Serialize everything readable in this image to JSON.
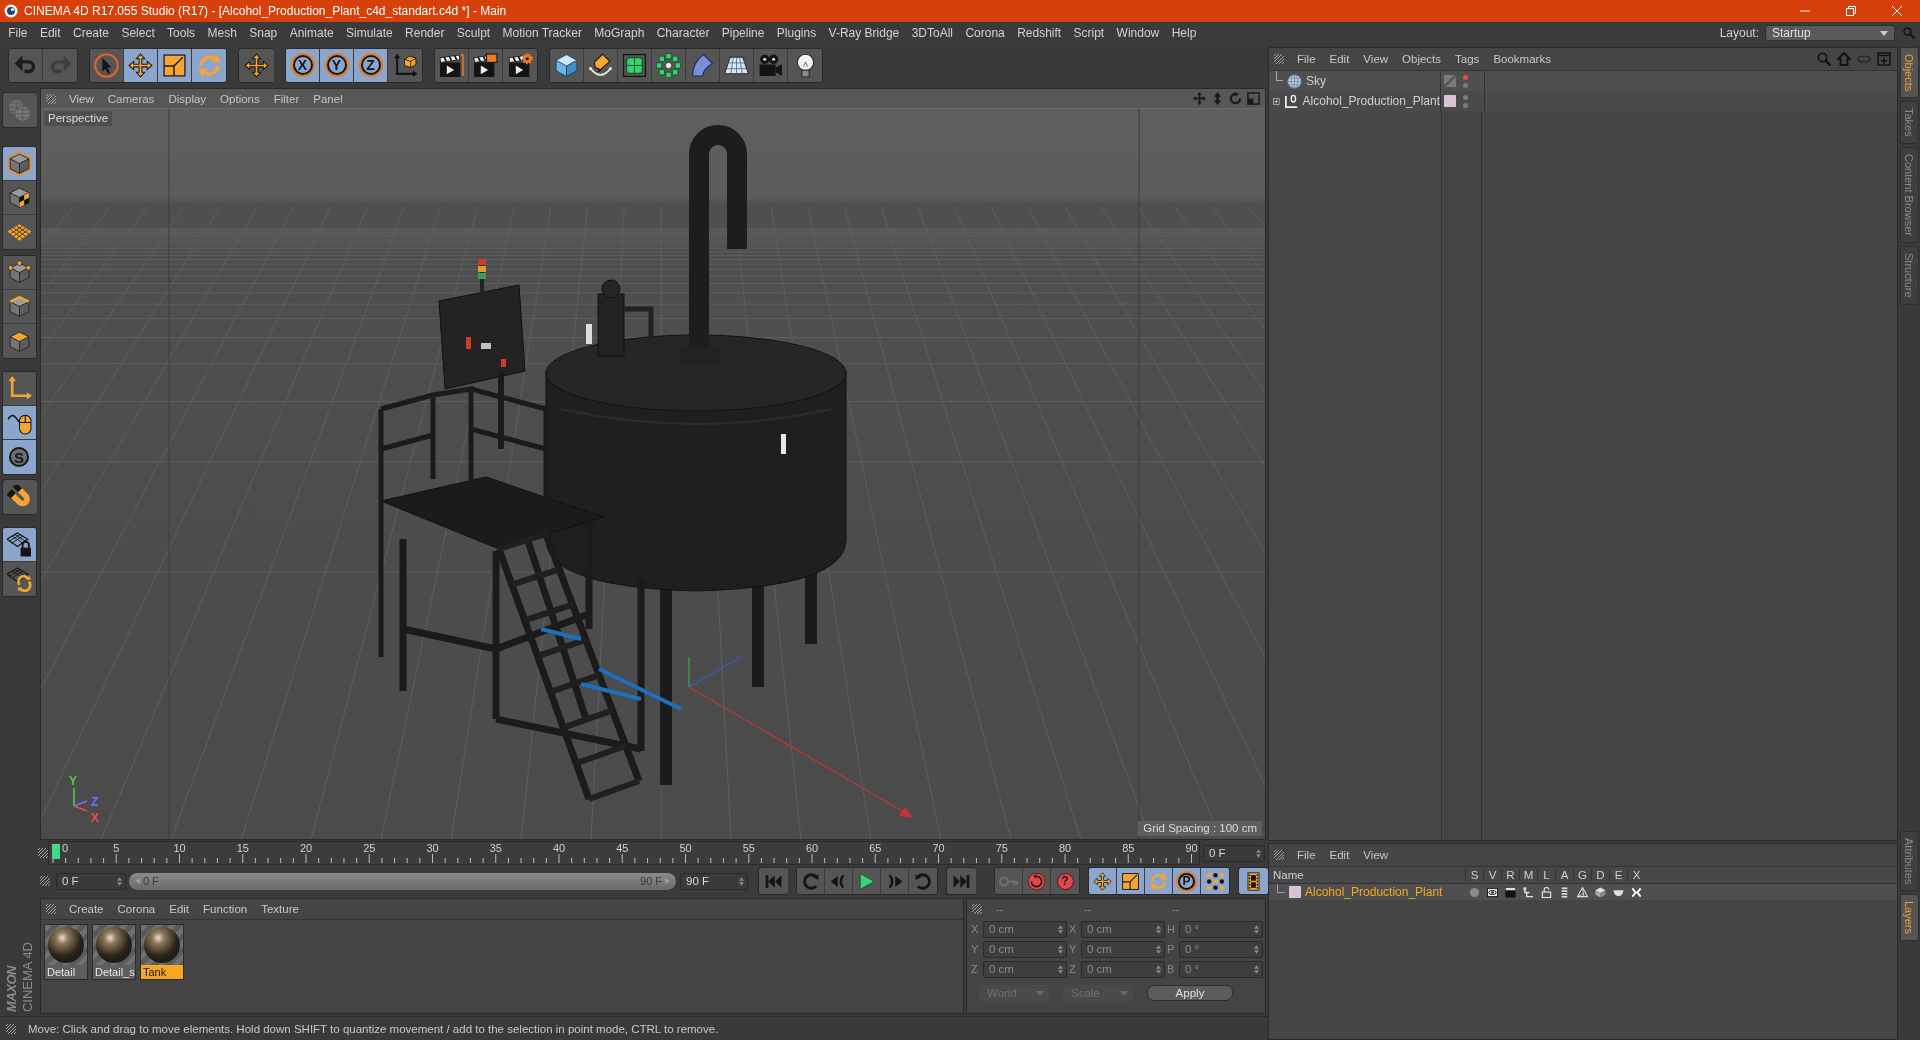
{
  "window": {
    "title": "CINEMA 4D R17.055 Studio (R17) - [Alcohol_Production_Plant_c4d_standart.c4d *] - Main"
  },
  "menu_bar": {
    "items": [
      "File",
      "Edit",
      "Create",
      "Select",
      "Tools",
      "Mesh",
      "Snap",
      "Animate",
      "Simulate",
      "Render",
      "Sculpt",
      "Motion Tracker",
      "MoGraph",
      "Character",
      "Pipeline",
      "Plugins",
      "V-Ray Bridge",
      "3DToAll",
      "Corona",
      "Redshift",
      "Script",
      "Window",
      "Help"
    ],
    "layout_label": "Layout:",
    "layout_value": "Startup"
  },
  "toolbar": [
    [
      {
        "active": false,
        "disabled": false
      },
      {
        "active": false,
        "disabled": true
      }
    ],
    [
      {
        "active": false,
        "disabled": false
      },
      {
        "active": true,
        "disabled": false
      },
      {
        "active": true,
        "disabled": false
      },
      {
        "active": true,
        "disabled": false
      }
    ],
    [
      {
        "active": false,
        "disabled": false
      }
    ],
    [
      {
        "active": true,
        "disabled": false,
        "label": "X"
      },
      {
        "active": true,
        "disabled": false,
        "label": "Y"
      },
      {
        "active": true,
        "disabled": false,
        "label": "Z"
      },
      {
        "active": false,
        "disabled": false
      }
    ],
    [
      {
        "active": false,
        "disabled": false
      },
      {
        "active": false,
        "disabled": false
      },
      {
        "active": false,
        "disabled": false
      }
    ],
    [
      {
        "active": false,
        "disabled": false
      },
      {
        "active": false,
        "disabled": false
      },
      {
        "active": false,
        "disabled": false
      },
      {
        "active": false,
        "disabled": false
      },
      {
        "active": false,
        "disabled": false
      },
      {
        "active": false,
        "disabled": false
      },
      {
        "active": false,
        "disabled": false
      },
      {
        "active": false,
        "disabled": false
      }
    ]
  ],
  "tool_palette": [
    [
      {
        "active": false,
        "disabled": true
      }
    ],
    [
      {
        "active": true,
        "disabled": false
      },
      {
        "active": false,
        "disabled": false
      },
      {
        "active": false,
        "disabled": false
      }
    ],
    [
      {
        "active": false,
        "disabled": false
      },
      {
        "active": false,
        "disabled": false
      },
      {
        "active": false,
        "disabled": false
      }
    ],
    [
      {
        "active": false,
        "disabled": false
      },
      {
        "active": true,
        "disabled": false
      },
      {
        "active": true,
        "disabled": false,
        "label": "S"
      }
    ],
    [
      {
        "active": false,
        "disabled": false
      }
    ],
    [
      {
        "active": true,
        "disabled": false
      },
      {
        "active": false,
        "disabled": false
      }
    ]
  ],
  "viewport": {
    "menu": [
      "View",
      "Cameras",
      "Display",
      "Options",
      "Filter",
      "Panel"
    ],
    "camera": "Perspective",
    "grid_spacing": "Grid Spacing : 100 cm",
    "axis_labels": [
      {
        "label": "Y",
        "color": "#44d044"
      },
      {
        "label": "Z",
        "color": "#7070ff"
      },
      {
        "label": "X",
        "color": "#ee4a4a"
      }
    ]
  },
  "timeline": {
    "ticks": [
      "0",
      "5",
      "10",
      "15",
      "20",
      "25",
      "30",
      "35",
      "40",
      "45",
      "50",
      "55",
      "60",
      "65",
      "70",
      "75",
      "80",
      "85",
      "90"
    ],
    "playhead": {
      "level": 0
    },
    "current_frame": "0 F"
  },
  "playback": {
    "start_frame": "0 F",
    "range": {
      "start": "0 F",
      "end": "90 F",
      "level": 1
    },
    "end_frame": "90 F"
  },
  "key_tools": [
    [
      {
        "active": false,
        "disabled": true
      },
      {
        "active": false,
        "disabled": false
      },
      {
        "active": false,
        "disabled": false,
        "label": "?"
      }
    ],
    [
      {
        "active": true,
        "disabled": false
      },
      {
        "active": true,
        "disabled": false
      },
      {
        "active": true,
        "disabled": false
      },
      {
        "active": true,
        "disabled": false,
        "label": "P"
      },
      {
        "active": true,
        "disabled": false
      }
    ],
    [
      {
        "active": true,
        "disabled": false
      }
    ]
  ],
  "material_manager": {
    "menu": [
      "Create",
      "Corona",
      "Edit",
      "Function",
      "Texture"
    ],
    "materials": [
      {
        "name": "Detail",
        "selected": false
      },
      {
        "name": "Detail_s",
        "selected": false
      },
      {
        "name": "Tank",
        "selected": true
      }
    ]
  },
  "coordinates": {
    "headers": [
      "--",
      "--",
      "--"
    ],
    "rows": [
      {
        "position_axis": "X",
        "position": "0 cm",
        "size_axis": "X",
        "size": "0 cm",
        "rotation_axis": "H",
        "rotation": "0 °"
      },
      {
        "position_axis": "Y",
        "position": "0 cm",
        "size_axis": "Y",
        "size": "0 cm",
        "rotation_axis": "P",
        "rotation": "0 °"
      },
      {
        "position_axis": "Z",
        "position": "0 cm",
        "size_axis": "Z",
        "size": "0 cm",
        "rotation_axis": "B",
        "rotation": "0 °"
      }
    ],
    "space": "World",
    "mode": "Scale",
    "apply": "Apply"
  },
  "status_bar": {
    "text": "Move: Click and drag to move elements. Hold down SHIFT to quantize movement / add to the selection in point mode, CTRL to remove."
  },
  "brand": {
    "company": "MAXON",
    "product": "CINEMA 4D"
  },
  "object_manager": {
    "menu": [
      "File",
      "Edit",
      "View",
      "Objects",
      "Tags",
      "Bookmarks"
    ],
    "objects": [
      {
        "name": "Sky",
        "kind": "sky",
        "expandable": false,
        "visibility_dots": [
          {
            "color": "#e05252"
          },
          {
            "color": "#7c7c7c"
          }
        ]
      },
      {
        "name": "Alcohol_Production_Plant",
        "kind": "null",
        "expandable": true,
        "color": "#d9c4d5",
        "visibility_dots": [
          {
            "color": "#7c7c7c"
          },
          {
            "color": "#7c7c7c"
          }
        ]
      }
    ]
  },
  "layer_manager": {
    "menu": [
      "File",
      "Edit",
      "View"
    ],
    "columns": [
      "Name",
      "S",
      "V",
      "R",
      "M",
      "L",
      "A",
      "G",
      "D",
      "E",
      "X"
    ],
    "layers": [
      {
        "name": "Alcohol_Production_Plant",
        "color": "#d9c4d5",
        "selected": true
      }
    ]
  },
  "side_tabs": {
    "top": [
      {
        "label": "Objects",
        "selected": true
      },
      {
        "label": "Takes",
        "selected": false
      },
      {
        "label": "Content Browser",
        "selected": false
      },
      {
        "label": "Structure",
        "selected": false
      }
    ],
    "bottom": [
      {
        "label": "Attributes",
        "selected": false
      },
      {
        "label": "Layers",
        "selected": true
      }
    ]
  }
}
